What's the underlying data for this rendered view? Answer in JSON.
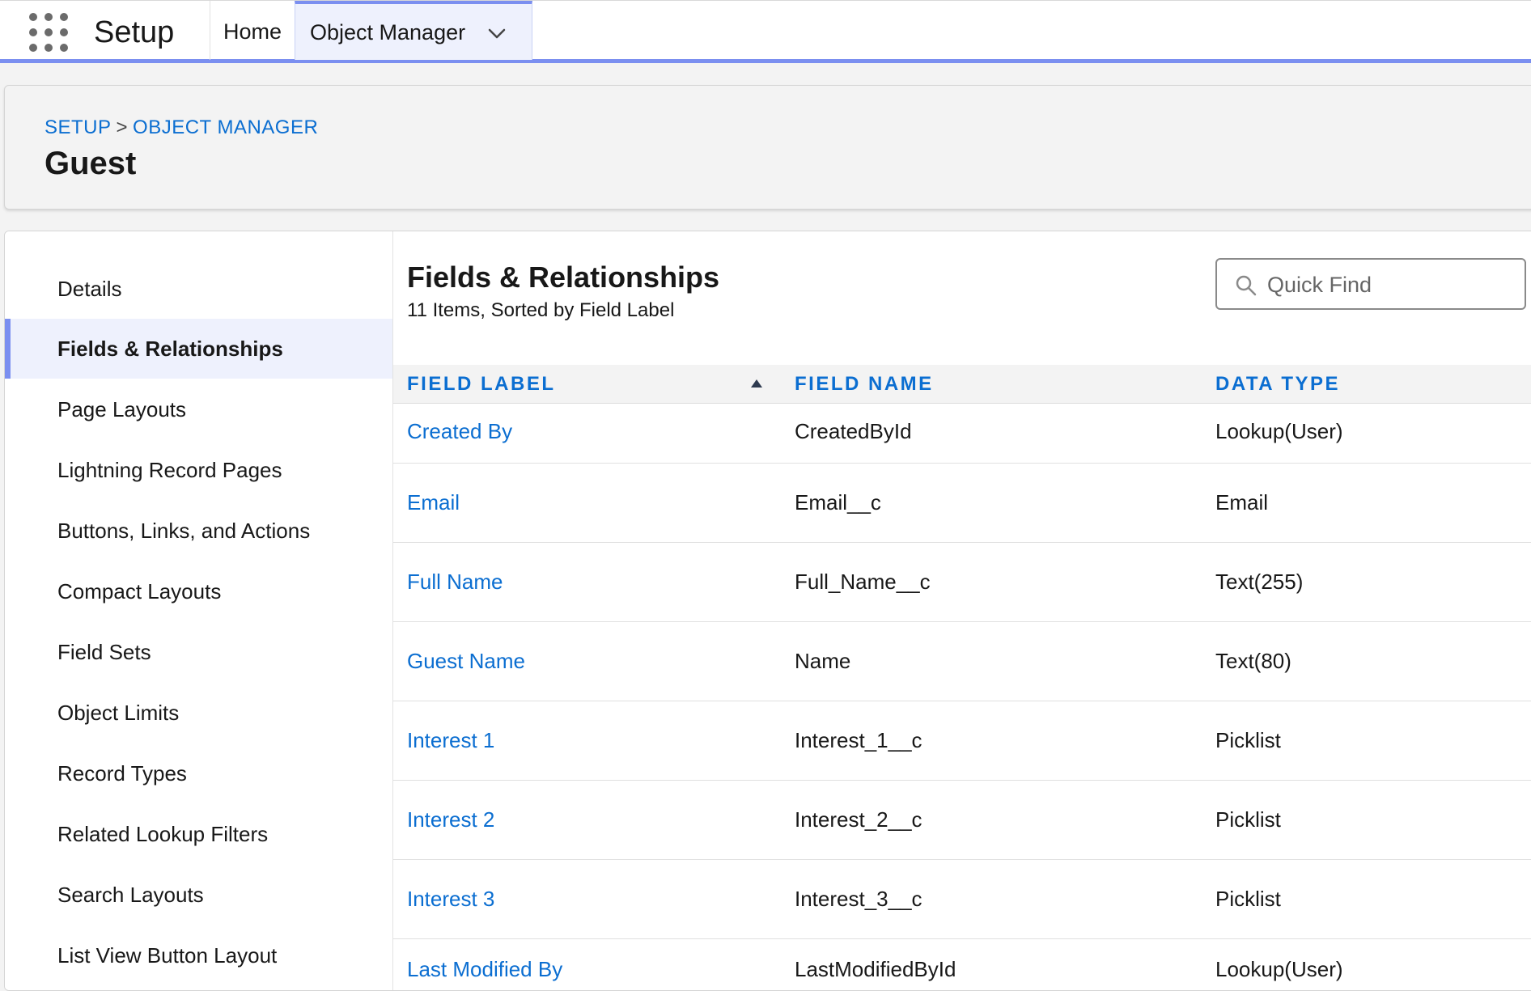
{
  "app": {
    "name": "Setup"
  },
  "tabs": {
    "home": "Home",
    "object_manager": "Object Manager"
  },
  "breadcrumb": {
    "setup": "SETUP",
    "separator": ">",
    "object_manager": "OBJECT MANAGER"
  },
  "object": {
    "title": "Guest"
  },
  "sidebar": {
    "items": [
      {
        "label": "Details"
      },
      {
        "label": "Fields & Relationships",
        "active": true
      },
      {
        "label": "Page Layouts"
      },
      {
        "label": "Lightning Record Pages"
      },
      {
        "label": "Buttons, Links, and Actions"
      },
      {
        "label": "Compact Layouts"
      },
      {
        "label": "Field Sets"
      },
      {
        "label": "Object Limits"
      },
      {
        "label": "Record Types"
      },
      {
        "label": "Related Lookup Filters"
      },
      {
        "label": "Search Layouts"
      },
      {
        "label": "List View Button Layout"
      }
    ]
  },
  "section": {
    "title": "Fields & Relationships",
    "subtitle": "11 Items, Sorted by Field Label",
    "quick_find_placeholder": "Quick Find"
  },
  "table": {
    "columns": {
      "label": "FIELD LABEL",
      "name": "FIELD NAME",
      "type": "DATA TYPE"
    },
    "rows": [
      {
        "label": "Created By",
        "name": "CreatedById",
        "type": "Lookup(User)"
      },
      {
        "label": "Email",
        "name": "Email__c",
        "type": "Email"
      },
      {
        "label": "Full Name",
        "name": "Full_Name__c",
        "type": "Text(255)"
      },
      {
        "label": "Guest Name",
        "name": "Name",
        "type": "Text(80)"
      },
      {
        "label": "Interest 1",
        "name": "Interest_1__c",
        "type": "Picklist"
      },
      {
        "label": "Interest 2",
        "name": "Interest_2__c",
        "type": "Picklist"
      },
      {
        "label": "Interest 3",
        "name": "Interest_3__c",
        "type": "Picklist"
      },
      {
        "label": "Last Modified By",
        "name": "LastModifiedById",
        "type": "Lookup(User)"
      }
    ]
  },
  "colors": {
    "accent": "#7b8ff0",
    "link": "#0b6ed1",
    "active_bg": "#eef1fd"
  }
}
